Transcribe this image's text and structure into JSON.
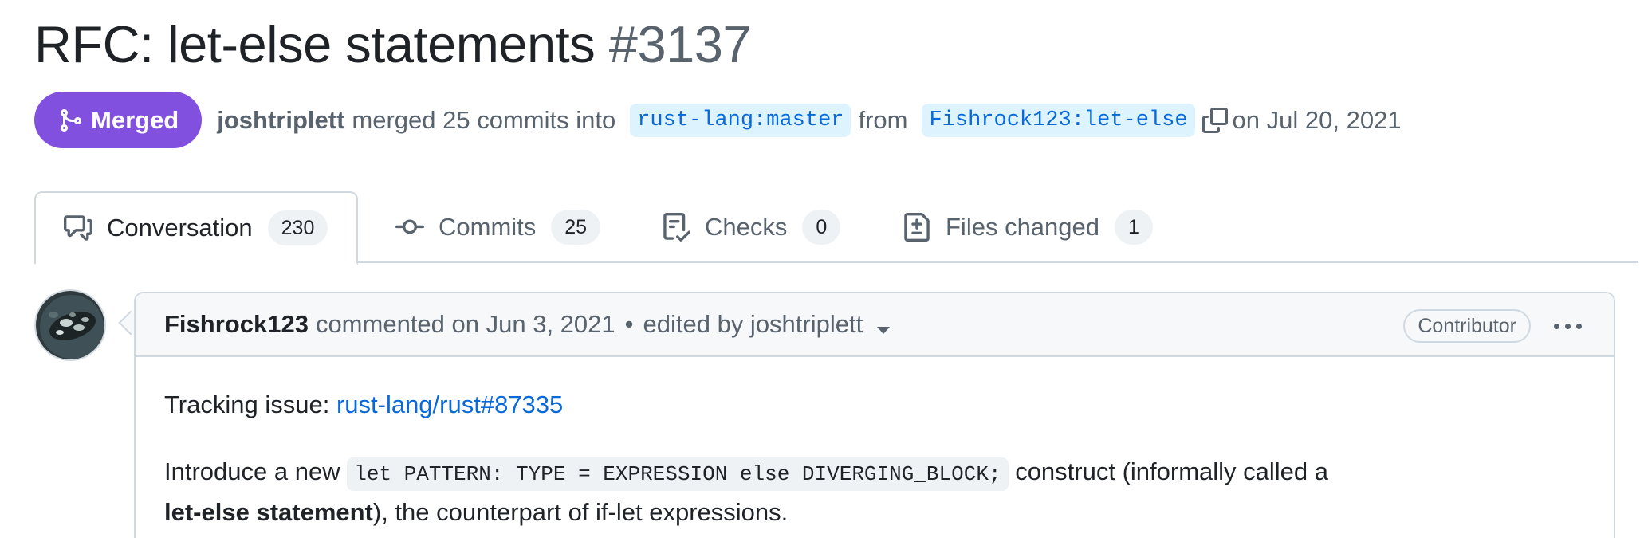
{
  "pr": {
    "title": "RFC: let-else statements",
    "number": "#3137",
    "state": "Merged",
    "author": "joshtriplett",
    "merged_text": "merged 25 commits into",
    "base_branch": "rust-lang:master",
    "from_text": "from",
    "head_branch": "Fishrock123:let-else",
    "date_text": "on Jul 20, 2021"
  },
  "tabs": [
    {
      "label": "Conversation",
      "count": "230",
      "icon": "comment-discussion-icon"
    },
    {
      "label": "Commits",
      "count": "25",
      "icon": "git-commit-icon"
    },
    {
      "label": "Checks",
      "count": "0",
      "icon": "checklist-icon"
    },
    {
      "label": "Files changed",
      "count": "1",
      "icon": "file-diff-icon"
    }
  ],
  "comment": {
    "author": "Fishrock123",
    "commented_text": "commented on Jun 3, 2021",
    "separator": "•",
    "edited_text": "edited by joshtriplett",
    "role": "Contributor",
    "tracking_label": "Tracking issue:",
    "tracking_link": "rust-lang/rust#87335",
    "p2_intro": "Introduce a new",
    "p2_code": "let PATTERN: TYPE = EXPRESSION else DIVERGING_BLOCK;",
    "p2_mid": "construct (informally called a",
    "p2_bold": "let-else statement",
    "p2_end": "), the counterpart of if-let expressions."
  },
  "colors": {
    "merged": "#8250df",
    "link": "#0969da",
    "branch_bg": "#ddf4ff",
    "muted": "#59636e",
    "border": "#d1d9e0"
  }
}
